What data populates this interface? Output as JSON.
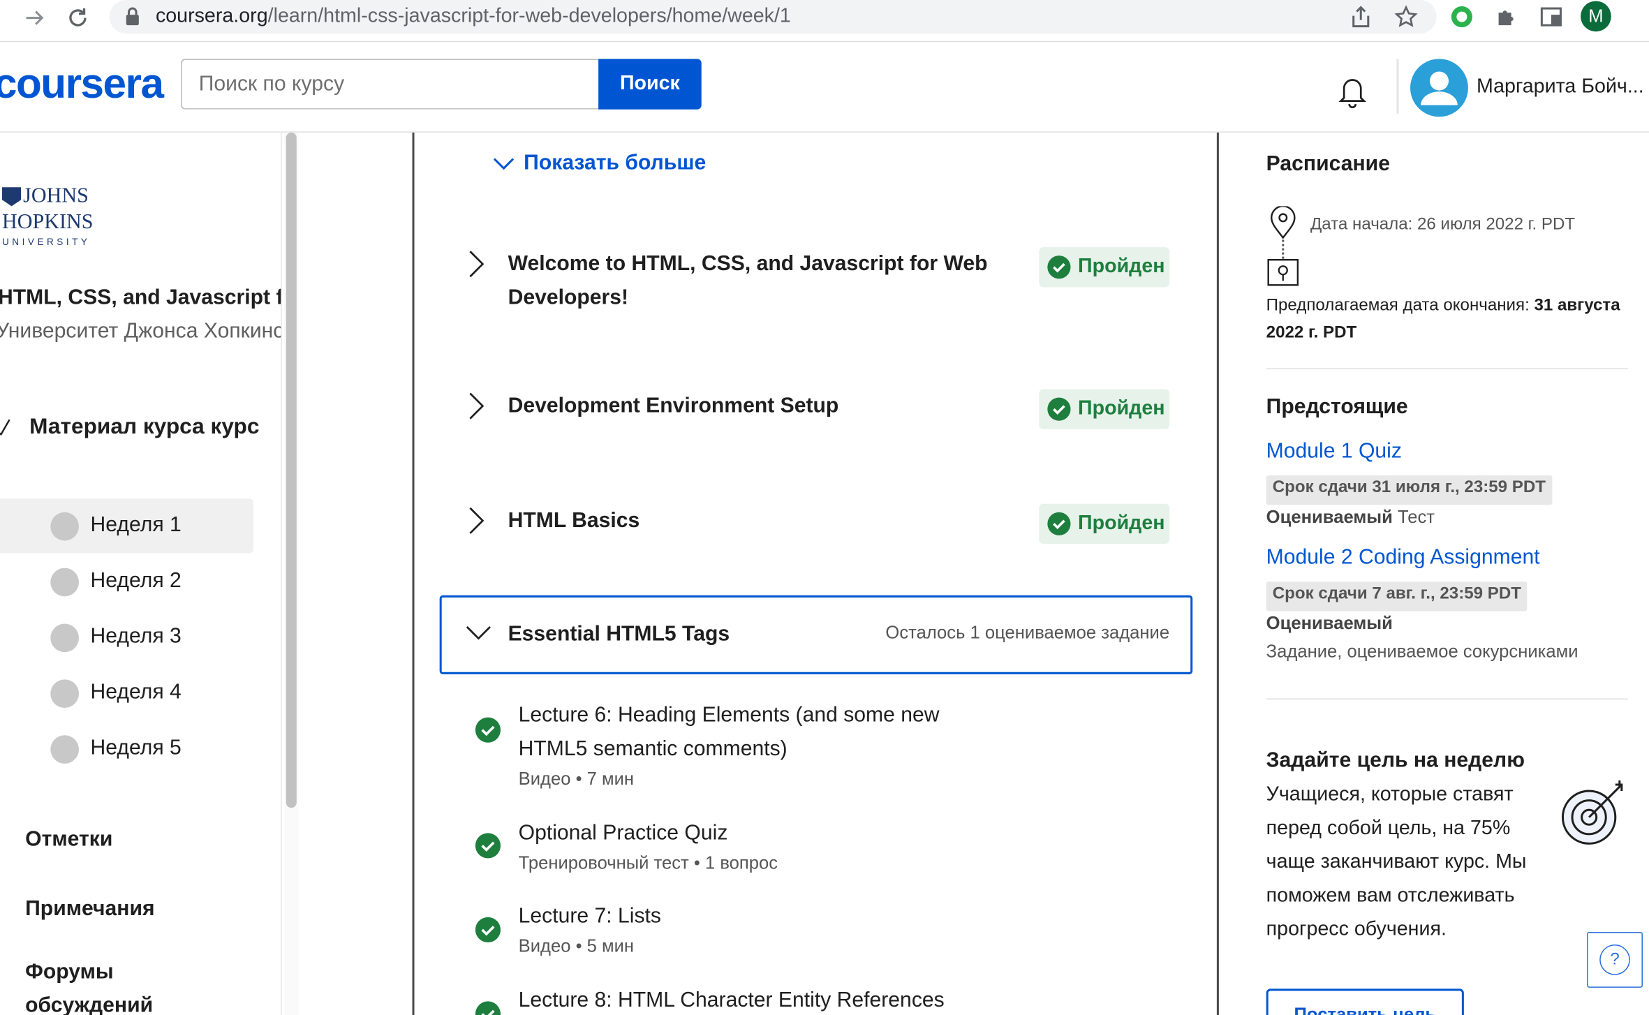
{
  "browser": {
    "url_host": "coursera.org",
    "url_path": "/learn/html-css-javascript-for-web-developers/home/week/1",
    "profile_initial": "M"
  },
  "header": {
    "logo": "coursera",
    "search_placeholder": "Поиск по курсу",
    "search_button": "Поиск",
    "user_name": "Маргарита Бойч..."
  },
  "sidebar": {
    "university_logo": [
      "JOHNS",
      "HOPKINS",
      "UNIVERSITY"
    ],
    "course_title": "HTML, CSS, and Javascript for Web Developers",
    "course_university": "Университет Джонса Хопкинса",
    "material_label": "Материал курса курс",
    "weeks": [
      "Неделя 1",
      "Неделя 2",
      "Неделя 3",
      "Неделя 4",
      "Неделя 5"
    ],
    "active_week": 0,
    "links": [
      "Отметки",
      "Примечания",
      "Форумы обсуждений"
    ]
  },
  "main": {
    "show_more": "Показать больше",
    "modules": [
      {
        "title": "Welcome to HTML, CSS, and Javascript for Web Developers!",
        "status": "Пройден"
      },
      {
        "title": "Development Environment Setup",
        "status": "Пройден"
      },
      {
        "title": "HTML Basics",
        "status": "Пройден"
      }
    ],
    "expanded_module": {
      "title": "Essential HTML5 Tags",
      "remaining": "Осталось 1 оцениваемое задание",
      "items": [
        {
          "title": "Lecture 6: Heading Elements (and some new HTML5 semantic comments)",
          "meta": "Видео • 7 мин",
          "done": true
        },
        {
          "title": "Optional Practice Quiz",
          "meta": "Тренировочный тест • 1 вопрос",
          "done": true
        },
        {
          "title": "Lecture 7: Lists",
          "meta": "Видео • 5 мин",
          "done": true
        },
        {
          "title": "Lecture 8: HTML Character Entity References",
          "meta": "",
          "done": true
        }
      ]
    }
  },
  "right": {
    "schedule_title": "Расписание",
    "start_date": "Дата начала: 26 июля 2022 г. PDT",
    "end_date_label": "Предполагаемая дата окончания: ",
    "end_date_value": "31 августа 2022 г. PDT",
    "upcoming_title": "Предстоящие",
    "upcoming": [
      {
        "title": "Module 1 Quiz",
        "due": "Срок сдачи 31 июля г., 23:59 PDT",
        "graded": "Оцениваемый",
        "kind": " Тест"
      },
      {
        "title": "Module 2 Coding Assignment",
        "due": "Срок сдачи 7 авг. г., 23:59 PDT",
        "graded": "Оцениваемый",
        "kind": "Задание, оцениваемое сокурсниками"
      }
    ],
    "goal_title": "Задайте цель на неделю",
    "goal_text": "Учащиеся, которые ставят перед собой цель, на 75% чаще заканчивают курс. Мы поможем вам отслеживать прогресс обучения.",
    "goal_button": "Поставить цель",
    "help_icon": "?"
  },
  "colors": {
    "brand": "#0056d2",
    "success": "#1e7e3e",
    "success_bg": "#e6f2ea"
  }
}
